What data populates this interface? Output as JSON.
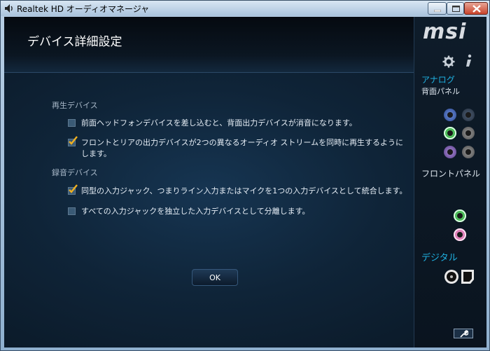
{
  "window": {
    "title": "Realtek HD オーディオマネージャ"
  },
  "header": {
    "title": "デバイス詳細設定"
  },
  "playback": {
    "label": "再生デバイス",
    "options": [
      {
        "text": "前面ヘッドフォンデバイスを差し込むと、背面出力デバイスが消音になります。",
        "checked": false
      },
      {
        "text": "フロントとリアの出力デバイスが2つの異なるオーディオ ストリームを同時に再生するようにします。",
        "checked": true
      }
    ]
  },
  "recording": {
    "label": "録音デバイス",
    "options": [
      {
        "text": "同型の入力ジャック、つまりライン入力またはマイクを1つの入力デバイスとして統合します。",
        "checked": true
      },
      {
        "text": "すべての入力ジャックを独立した入力デバイスとして分離します。",
        "checked": false
      }
    ]
  },
  "ok_button": {
    "label": "OK"
  },
  "side_panel": {
    "logo": "msi",
    "analog_label": "アナログ",
    "rear_panel_label": "背面パネル",
    "front_panel_label": "フロントパネル",
    "digital_label": "デジタル"
  },
  "colors": {
    "accent": "#1fb0e0",
    "check": "#f0b020"
  }
}
